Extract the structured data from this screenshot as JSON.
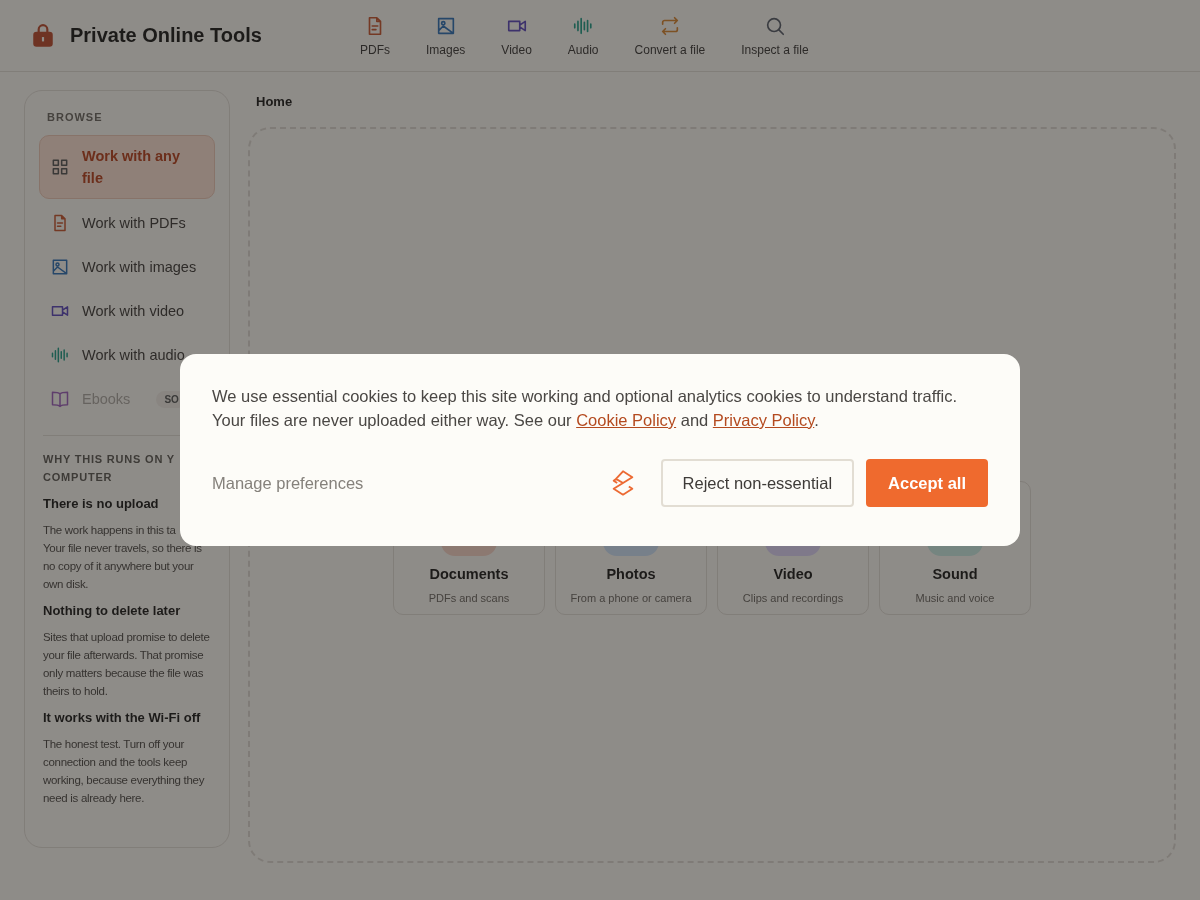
{
  "brand": {
    "title": "Private Online Tools"
  },
  "nav": [
    {
      "label": "PDFs",
      "kind": "pdf"
    },
    {
      "label": "Images",
      "kind": "image"
    },
    {
      "label": "Video",
      "kind": "video"
    },
    {
      "label": "Audio",
      "kind": "audio"
    },
    {
      "label": "Convert a file",
      "kind": "convert"
    },
    {
      "label": "Inspect a file",
      "kind": "search"
    }
  ],
  "sidebar": {
    "heading": "BROWSE",
    "items": [
      {
        "label": "Work with any file",
        "kind": "grid",
        "selected": true,
        "disabled": false
      },
      {
        "label": "Work with PDFs",
        "kind": "pdf",
        "selected": false,
        "disabled": false
      },
      {
        "label": "Work with images",
        "kind": "image",
        "selected": false,
        "disabled": false
      },
      {
        "label": "Work with video",
        "kind": "video",
        "selected": false,
        "disabled": false
      },
      {
        "label": "Work with audio",
        "kind": "audio",
        "selected": false,
        "disabled": false
      },
      {
        "label": "Ebooks",
        "kind": "book",
        "selected": false,
        "disabled": true,
        "badge": "SO"
      }
    ],
    "why_heading": "WHY THIS RUNS ON Y",
    "why_heading_2": "COMPUTER",
    "points": [
      {
        "title": "There is no upload",
        "lines": [
          "The work happens in this ta",
          "Your file never travels, so there is no copy of it anywhere but your own disk."
        ]
      },
      {
        "title": "Nothing to delete later",
        "lines": [
          "Sites that upload promise to delete your file afterwards. That promise only matters because the file was theirs to hold."
        ]
      },
      {
        "title": "It works with the Wi-Fi off",
        "lines": [
          "The honest test. Turn off your connection and the tools keep working, because everything they need is already here."
        ]
      }
    ]
  },
  "breadcrumb": "Home",
  "categories": [
    {
      "title": "Documents",
      "subtitle": "PDFs and scans"
    },
    {
      "title": "Photos",
      "subtitle": "From a phone or camera"
    },
    {
      "title": "Video",
      "subtitle": "Clips and recordings"
    },
    {
      "title": "Sound",
      "subtitle": "Music and voice"
    }
  ],
  "cookie_banner": {
    "lines": [
      [
        {
          "kind": "text",
          "text": "We use essential cookies to keep this site working and optional analytics cookies to understand traffic."
        }
      ],
      [
        {
          "kind": "text",
          "text": "Your files are never uploaded either way. See our "
        },
        {
          "kind": "link",
          "text": "Cookie Policy"
        },
        {
          "kind": "text",
          "text": " and "
        },
        {
          "kind": "link",
          "text": "Privacy Policy"
        },
        {
          "kind": "text",
          "text": "."
        }
      ]
    ],
    "manage": "Manage preferences",
    "reject": "Reject non-essential",
    "accept": "Accept all"
  }
}
